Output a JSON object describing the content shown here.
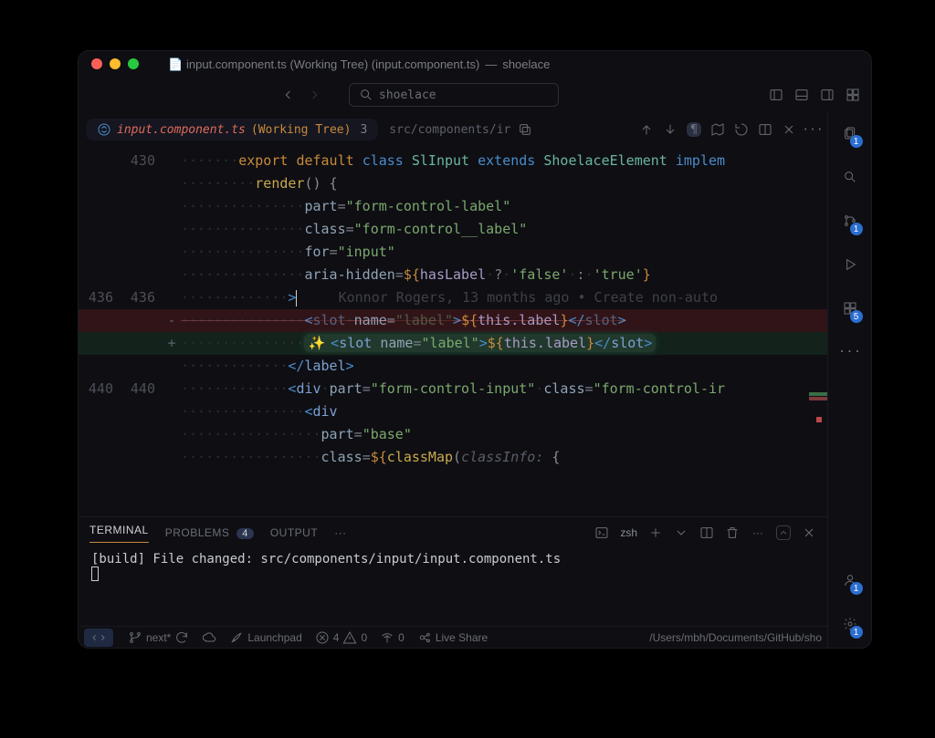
{
  "window": {
    "title_filename": "input.component.ts (Working Tree) (input.component.ts)",
    "title_project": "shoelace"
  },
  "search": {
    "placeholder": "shoelace"
  },
  "tab": {
    "icon": "copilot-icon",
    "filename": "input.component.ts",
    "suffix": "(Working Tree)",
    "count": "3",
    "path": "src/components/ir"
  },
  "activity": {
    "explorer_badge": "1",
    "scm_badge": "1",
    "extensions_badge": "5",
    "account_badge": "1",
    "settings_badge": "1"
  },
  "code": {
    "lines": [
      {
        "a": "",
        "b": "430",
        "sign": "",
        "html": "<span class='ws'>·······</span><span class='kw-export'>export</span> <span class='kw-default'>default</span> <span class='kw-class'>class</span> <span class='classname'>SlInput</span> <span class='kw-extends'>extends</span> <span class='classname'>ShoelaceElement</span> <span class='kw-implements'>implem</span>"
      },
      {
        "a": "",
        "b": "",
        "sign": "",
        "html": "<span class='ws'>·········</span><span class='method'>render</span><span class='punct'>() {</span>"
      },
      {
        "a": "",
        "b": "",
        "sign": "",
        "html": "<span class='ws'>···············</span><span class='attr'>part</span><span class='op'>=</span><span class='str'>\"form-control-label\"</span>"
      },
      {
        "a": "",
        "b": "",
        "sign": "",
        "html": "<span class='ws'>···············</span><span class='attr'>class</span><span class='op'>=</span><span class='str'>\"form-control__label\"</span>"
      },
      {
        "a": "",
        "b": "",
        "sign": "",
        "html": "<span class='ws'>···············</span><span class='attr'>for</span><span class='op'>=</span><span class='str'>\"input\"</span>"
      },
      {
        "a": "",
        "b": "",
        "sign": "",
        "html": "<span class='ws'>···············</span><span class='attr'>aria-hidden</span><span class='op'>=</span><span class='interp'>${</span><span class='var'>hasLabel</span><span class='ws'>·</span><span class='op'>?</span><span class='ws'>·</span><span class='str'>'false'</span><span class='ws'>·</span><span class='op'>:</span><span class='ws'>·</span><span class='str'>'true'</span><span class='interp'>}</span>"
      },
      {
        "a": "436",
        "b": "436",
        "sign": "",
        "cursor": true,
        "html": "<span class='ws'>·············</span><span class='tag'>&gt;</span><span class='cursor'></span>     <span class='blame'>Konnor Rogers, 13 months ago • Create non-auto</span>"
      },
      {
        "a": "",
        "b": "",
        "sign": "-",
        "cls": "diff-del",
        "html": "<span class='ws'>···············</span><span class='tag'>&lt;</span><span class='tagname'>slot</span><span class='ws'>·</span><span class='attr'>name</span><span class='op'>=</span><span class='str'>\"label\"</span><span class='tag'>&gt;</span><span class='interp'>${</span><span class='var'>this.label</span><span class='interp'>}</span><span class='tag'>&lt;/</span><span class='tagname'>slot</span><span class='tag'>&gt;</span>"
      },
      {
        "a": "",
        "b": "",
        "sign": "+",
        "cls": "diff-add",
        "html": "<span class='ws'>···············</span><span class='highlight-box'><span class='sparkle'>✨</span><span class='tag'>&lt;</span><span class='tagname'>slot</span><span class='ws'>·</span><span class='attr'>name</span><span class='op'>=</span><span class='str'>\"label\"</span><span class='tag'>&gt;</span><span class='interp'>${</span><span class='var'>this.label</span><span class='interp'>}</span><span class='tag'>&lt;/</span><span class='tagname'>slot</span><span class='tag'>&gt;</span></span>"
      },
      {
        "a": "",
        "b": "",
        "sign": "",
        "html": "<span class='ws'>·············</span><span class='tag'>&lt;/</span><span class='tagname'>label</span><span class='tag'>&gt;</span>"
      },
      {
        "a": "",
        "b": "",
        "sign": "",
        "html": ""
      },
      {
        "a": "440",
        "b": "440",
        "sign": "",
        "html": "<span class='ws'>·············</span><span class='tag'>&lt;</span><span class='tagname'>div</span><span class='ws'>·</span><span class='attr'>part</span><span class='op'>=</span><span class='str'>\"form-control-input\"</span><span class='ws'>·</span><span class='attr'>class</span><span class='op'>=</span><span class='str'>\"form-control-ir</span>"
      },
      {
        "a": "",
        "b": "",
        "sign": "",
        "html": "<span class='ws'>···············</span><span class='tag'>&lt;</span><span class='tagname'>div</span>"
      },
      {
        "a": "",
        "b": "",
        "sign": "",
        "html": "<span class='ws'>·················</span><span class='attr'>part</span><span class='op'>=</span><span class='str'>\"base\"</span>"
      },
      {
        "a": "",
        "b": "",
        "sign": "",
        "html": "<span class='ws'>·················</span><span class='attr'>class</span><span class='op'>=</span><span class='interp'>${</span><span class='method'>classMap</span><span class='punct'>(</span><span class='param'>classInfo:</span> <span class='punct'>{</span>"
      }
    ]
  },
  "panel": {
    "tabs": {
      "terminal": "TERMINAL",
      "problems": "PROBLEMS",
      "problems_count": "4",
      "output": "OUTPUT"
    },
    "shell": "zsh",
    "body": "[build] File changed:  src/components/input/input.component.ts"
  },
  "status": {
    "branch": "next*",
    "launchpad": "Launchpad",
    "errors": "4",
    "warnings": "0",
    "ports": "0",
    "liveshare": "Live Share",
    "path": "/Users/mbh/Documents/GitHub/sho"
  }
}
